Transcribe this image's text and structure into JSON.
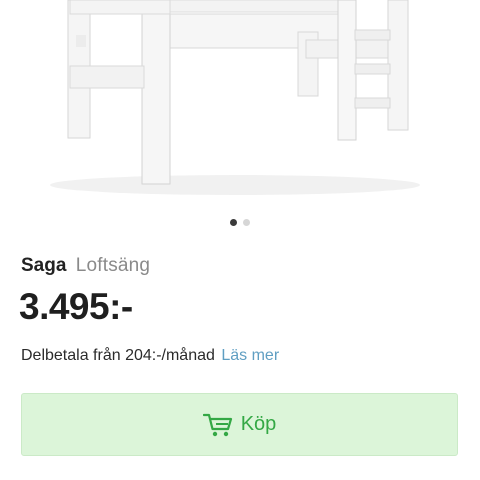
{
  "product": {
    "brand": "Saga",
    "type": "Loftsäng",
    "price": "3.495:-"
  },
  "carousel": {
    "total": 2,
    "active": 1
  },
  "installment": {
    "text": "Delbetala från 204:-/månad",
    "link_label": "Läs mer"
  },
  "buy_button": {
    "label": "Köp",
    "icon": "cart-icon"
  },
  "colors": {
    "accent_green": "#34a845",
    "button_bg": "#dcf5d9",
    "link_blue": "#5f9ec2"
  }
}
